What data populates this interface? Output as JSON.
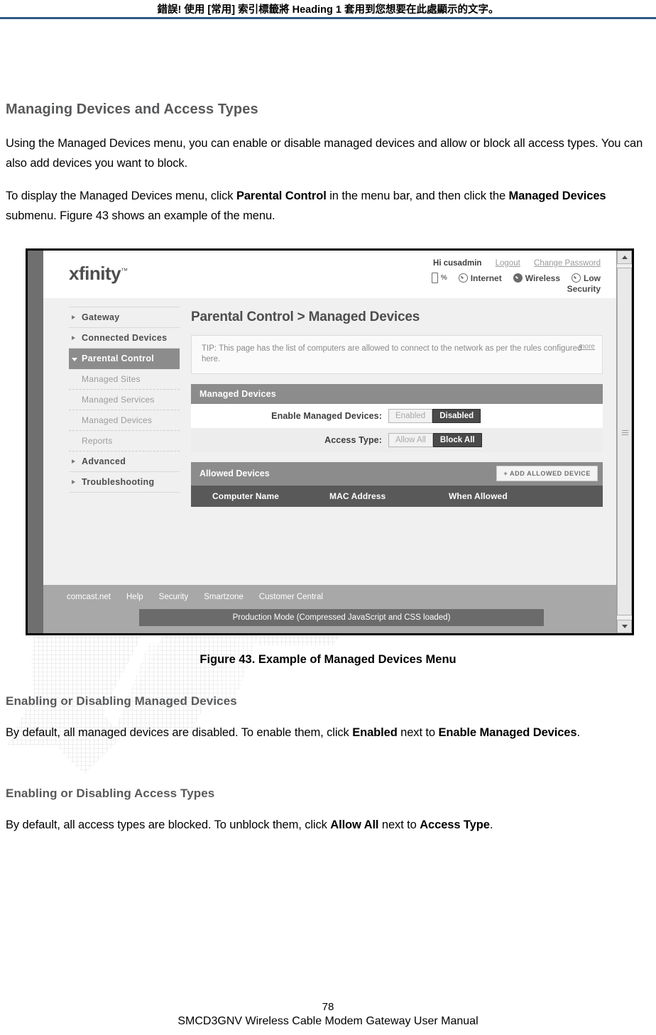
{
  "document": {
    "running_header": "錯誤! 使用 [常用] 索引標籤將 Heading 1 套用到您想要在此處顯示的文字。",
    "accent_rule_color": "#2e5a87",
    "page_number": "78",
    "manual_title": "SMCD3GNV Wireless Cable Modem Gateway User Manual"
  },
  "section": {
    "title": "Managing Devices and Access Types",
    "paragraph1": "Using the Managed Devices menu, you can enable or disable managed devices and allow or block all access types. You can also add devices you want to block.",
    "paragraph2_part1": "To display the Managed Devices menu, click ",
    "paragraph2_bold1": "Parental Control",
    "paragraph2_part2": " in the menu bar, and then click the ",
    "paragraph2_bold2": "Managed Devices",
    "paragraph2_part3": " submenu. Figure 43 shows an example of the menu."
  },
  "figure": {
    "caption": "Figure 43. Example of Managed Devices Menu",
    "app": {
      "logo": "xfinity",
      "logo_tm": "™",
      "account": {
        "greeting": "Hi cusadmin",
        "logout": "Logout",
        "change_password": "Change Password"
      },
      "status": {
        "battery_percent": "%",
        "internet": "Internet",
        "wireless": "Wireless",
        "security": "Low",
        "security_line2": "Security"
      },
      "sidebar": {
        "items": [
          {
            "label": "Gateway",
            "type": "top",
            "active": false
          },
          {
            "label": "Connected Devices",
            "type": "top",
            "active": false
          },
          {
            "label": "Parental Control",
            "type": "top",
            "active": true
          },
          {
            "label": "Managed Sites",
            "type": "sub",
            "active": false
          },
          {
            "label": "Managed Services",
            "type": "sub",
            "active": false
          },
          {
            "label": "Managed Devices",
            "type": "sub",
            "active": false
          },
          {
            "label": "Reports",
            "type": "sub",
            "active": false
          },
          {
            "label": "Advanced",
            "type": "top",
            "active": false
          },
          {
            "label": "Troubleshooting",
            "type": "top",
            "active": false
          }
        ]
      },
      "main": {
        "heading": "Parental Control > Managed Devices",
        "tip": "TIP: This page has the list of computers are allowed to connect to the network as per the rules configured here.",
        "tip_more": "more",
        "managed_devices_panel": {
          "title": "Managed Devices",
          "rows": [
            {
              "label": "Enable Managed Devices:",
              "options": [
                "Enabled",
                "Disabled"
              ],
              "selected": "Disabled"
            },
            {
              "label": "Access Type:",
              "options": [
                "Allow All",
                "Block All"
              ],
              "selected": "Block All"
            }
          ]
        },
        "allowed_devices_panel": {
          "title": "Allowed Devices",
          "add_button": "+ ADD ALLOWED DEVICE",
          "columns": [
            "Computer Name",
            "MAC Address",
            "When Allowed"
          ],
          "rows": []
        }
      },
      "footer": {
        "links": [
          "comcast.net",
          "Help",
          "Security",
          "Smartzone",
          "Customer Central"
        ],
        "production_mode": "Production Mode (Compressed JavaScript and CSS loaded)"
      }
    }
  },
  "subsections": [
    {
      "title": "Enabling or Disabling Managed Devices",
      "text_part1": "By default, all managed devices are disabled. To enable them, click ",
      "bold1": "Enabled",
      "text_part2": " next to ",
      "bold2": "Enable Managed Devices",
      "text_part3": "."
    },
    {
      "title": "Enabling or Disabling Access Types",
      "text_part1": "By default, all access types are blocked. To unblock them, click ",
      "bold1": "Allow All",
      "text_part2": " next to ",
      "bold2": "Access Type",
      "text_part3": "."
    }
  ]
}
